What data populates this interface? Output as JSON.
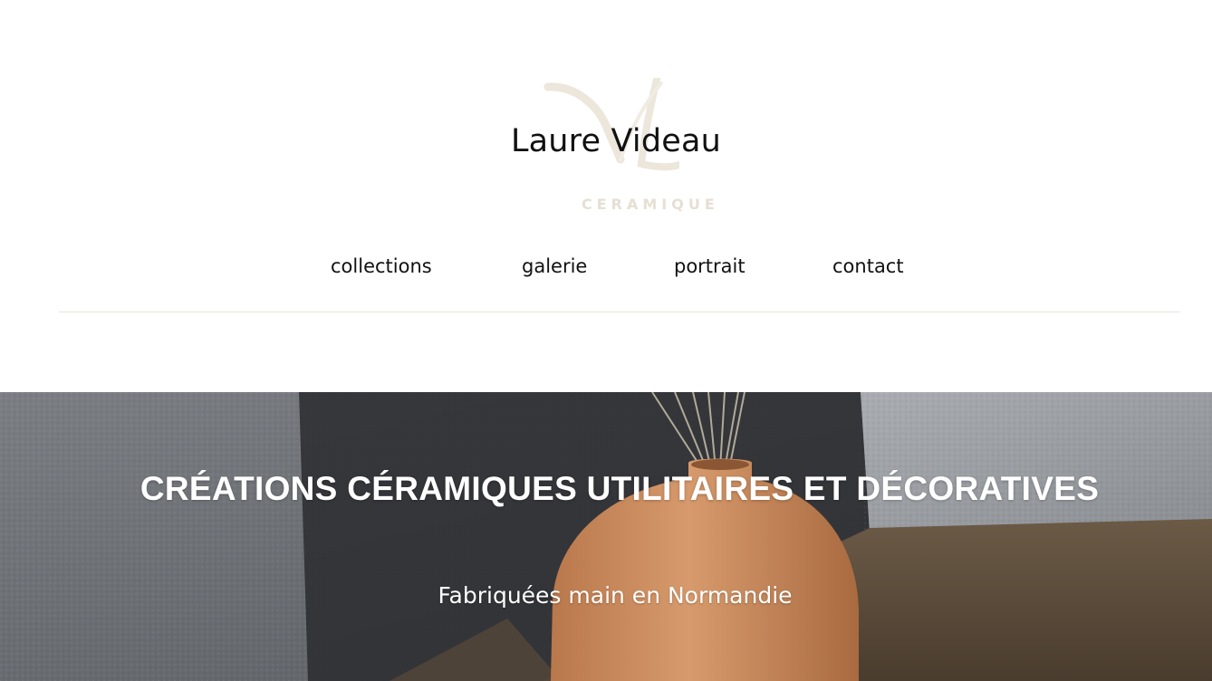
{
  "brand": {
    "title": "Laure Videau",
    "subtitle": "CERAMIQUE",
    "logo_icon": "vl-monogram-icon"
  },
  "nav": {
    "items": [
      {
        "label": "collections"
      },
      {
        "label": "galerie"
      },
      {
        "label": "portrait"
      },
      {
        "label": "contact"
      }
    ]
  },
  "hero": {
    "title": "CRÉATIONS CÉRAMIQUES UTILITAIRES ET DÉCORATIVES",
    "subtitle": "Fabriquées main en Normandie",
    "image": "terracotta-vase-with-dried-stems-photo"
  },
  "colors": {
    "text": "#111111",
    "logo_accent": "#e6dfd3",
    "divider": "#e8e3d6",
    "hero_text": "#ffffff",
    "vase": "#c98a5e"
  }
}
